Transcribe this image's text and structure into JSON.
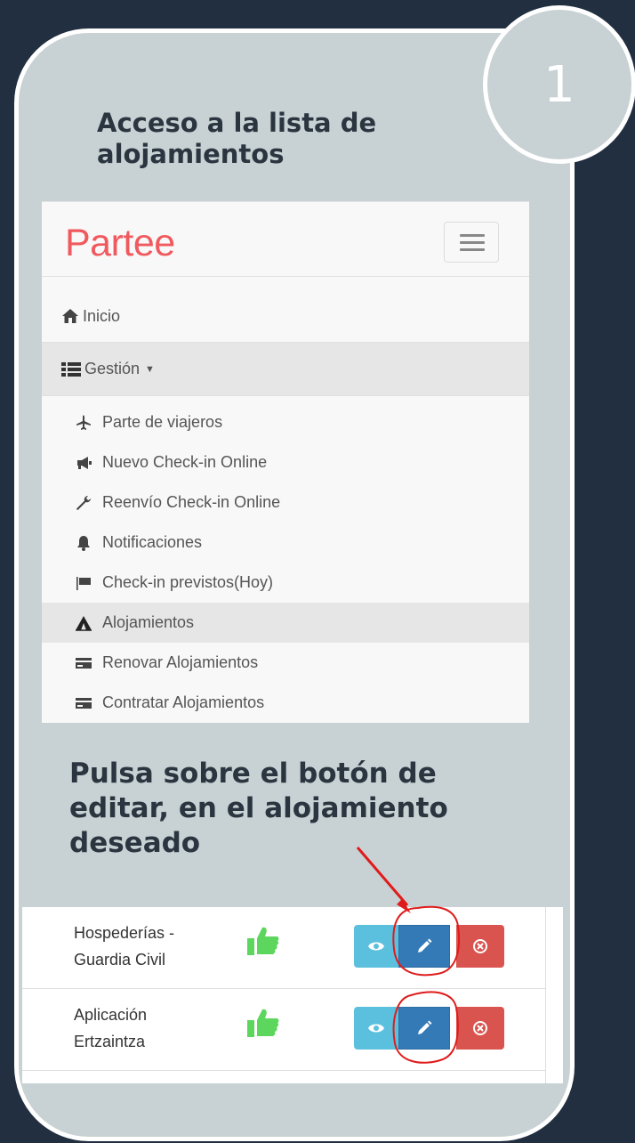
{
  "step": {
    "number": "1"
  },
  "heading_top": "Acceso a la lista de alojamientos",
  "heading_bottom": "Pulsa sobre el botón de editar, en el alojamiento deseado",
  "app": {
    "brand": "Partee",
    "menu_icon": "hamburger-icon",
    "nav": {
      "inicio": "Inicio",
      "gestion": "Gestión",
      "sub_items": [
        {
          "label": "Parte de viajeros",
          "icon": "plane-icon"
        },
        {
          "label": "Nuevo Check-in Online",
          "icon": "bullhorn-icon"
        },
        {
          "label": "Reenvío Check-in Online",
          "icon": "wrench-icon"
        },
        {
          "label": "Notificaciones",
          "icon": "bell-icon"
        },
        {
          "label": "Check-in previstos(Hoy)",
          "icon": "flag-icon"
        },
        {
          "label": "Alojamientos",
          "icon": "tent-icon",
          "active": true
        },
        {
          "label": "Renovar Alojamientos",
          "icon": "card-icon"
        },
        {
          "label": "Contratar Alojamientos",
          "icon": "card-icon"
        }
      ]
    }
  },
  "table": {
    "rows": [
      {
        "line1": "Hospederías -",
        "line2": "Guardia Civil",
        "status_icon": "thumbs-up-icon"
      },
      {
        "line1": "Aplicación",
        "line2": "Ertzaintza",
        "status_icon": "thumbs-up-icon"
      }
    ],
    "actions": [
      "view-icon",
      "edit-icon",
      "delete-icon"
    ]
  },
  "colors": {
    "background": "#212f40",
    "card": "#c8d1d3",
    "brand": "#f05a5f",
    "btn_view": "#5bc0de",
    "btn_edit": "#337ab7",
    "btn_delete": "#d9534f",
    "annotation": "#e01b1b",
    "thumb": "#5cd65c"
  }
}
